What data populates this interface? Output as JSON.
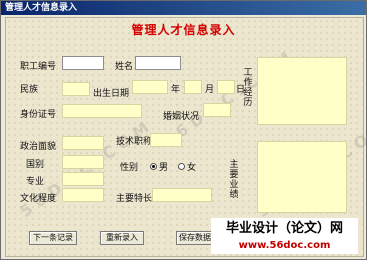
{
  "window": {
    "title": "管理人才信息录入"
  },
  "form": {
    "heading": "管理人才信息录入",
    "labels": {
      "employee_no": "职工编号",
      "name": "姓名",
      "ethnicity": "民族",
      "birth_date": "出生日期",
      "year": "年",
      "month": "月",
      "day": "日",
      "id_no": "身份证号",
      "marital_status": "婚姻状况",
      "political_status": "政治面貌",
      "technical_title": "技术职称",
      "nationality": "国别",
      "gender": "性别",
      "major": "专业",
      "education": "文化程度",
      "specialty": "主要特长",
      "work_experience": "工作经历",
      "main_achievements": "主要业绩"
    },
    "gender_options": [
      "男",
      "女"
    ],
    "gender_selected": "男"
  },
  "buttons": {
    "next_record": "下一条记录",
    "re_enter": "重新录入",
    "save": "保存数据"
  },
  "watermark": {
    "site": "5 6 D O C . C O M",
    "banner_top": "毕业设计（论文）网",
    "banner_url": "www.56doc.com"
  }
}
